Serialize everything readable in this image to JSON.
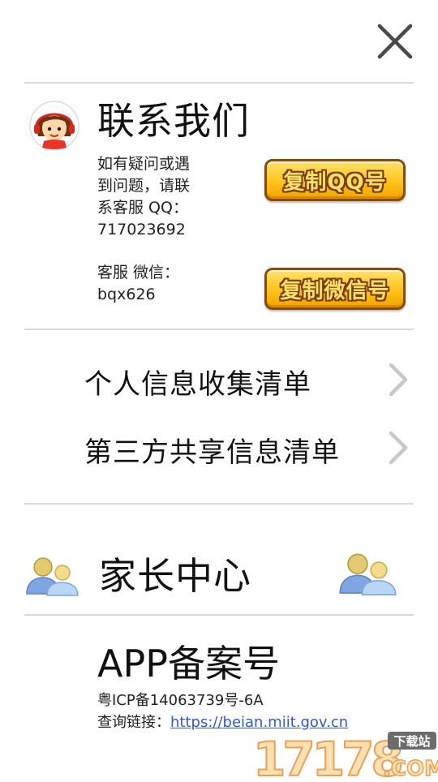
{
  "contact": {
    "title": "联系我们",
    "description_lines": [
      "如有疑问或遇",
      "到问题，请联",
      "系客服 QQ：",
      "717023692"
    ],
    "wechat_lines": [
      "客服 微信：",
      "bqx626"
    ],
    "copy_qq_button": "复制QQ号",
    "copy_wechat_button": "复制微信号"
  },
  "menu": {
    "items": [
      {
        "label": "个人信息收集清单"
      },
      {
        "label": "第三方共享信息清单"
      }
    ]
  },
  "parent_center": {
    "title": "家长中心"
  },
  "icp": {
    "title": "APP备案号",
    "record_number": "粤ICP备14063739号-6A",
    "query_label": "查询链接：",
    "query_link": "https://beian.miit.gov.cn"
  },
  "watermark": {
    "number": "17178",
    "tag": "下载站",
    "suffix": ".COM"
  },
  "icons": {
    "close": "close-icon",
    "avatar": "support-agent-avatar-icon",
    "chevron": "chevron-right-icon",
    "parents": "parents-icon"
  },
  "colors": {
    "button_gold": "#ffc31a",
    "button_border": "#8a4b08",
    "link": "#3457d5",
    "divider": "#d9d9d9",
    "parent_icon_blue": "#7fa6e0",
    "parent_icon_yellow": "#f5dc8c"
  }
}
